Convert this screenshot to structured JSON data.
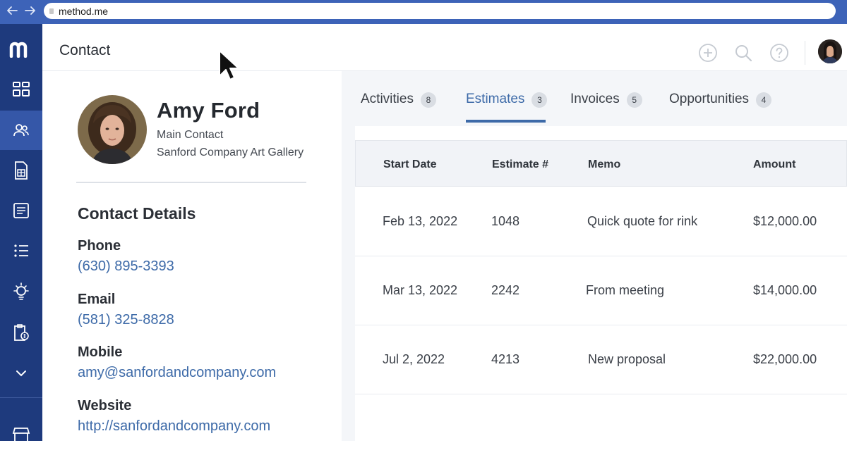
{
  "browser": {
    "url": "method.me"
  },
  "app": {
    "page_title": "Contact",
    "rail_items": [
      "dashboard-icon",
      "contacts-icon",
      "estimates-icon",
      "invoices-icon",
      "tasks-list-icon",
      "opportunities-icon",
      "payments-icon",
      "chevron-down-icon",
      "store-icon"
    ]
  },
  "contact": {
    "name": "Amy Ford",
    "role": "Main Contact",
    "company": "Sanford Company Art Gallery",
    "details_title": "Contact Details",
    "fields": [
      {
        "label": "Phone",
        "value": "(630) 895-3393"
      },
      {
        "label": "Email",
        "value": "(581) 325-8828"
      },
      {
        "label": "Mobile",
        "value": "amy@sanfordandcompany.com"
      },
      {
        "label": "Website",
        "value": "http://sanfordandcompany.com"
      }
    ]
  },
  "tabs": [
    {
      "label": "Activities",
      "count": "8"
    },
    {
      "label": "Estimates",
      "count": "3"
    },
    {
      "label": "Invoices",
      "count": "5"
    },
    {
      "label": "Opportunities",
      "count": "4"
    }
  ],
  "active_tab": "Estimates",
  "table": {
    "headers": [
      "Start Date",
      "Estimate #",
      "Memo",
      "Amount"
    ],
    "rows": [
      [
        "Feb 13, 2022",
        "1048",
        "Quick quote for rink",
        "$12,000.00"
      ],
      [
        "Mar 13, 2022",
        "2242",
        "From meeting",
        "$14,000.00"
      ],
      [
        "Jul 2, 2022",
        "4213",
        "New proposal",
        "$22,000.00"
      ]
    ]
  },
  "colors": {
    "rail": "#1e3a7d",
    "rail_active": "#3557a8",
    "accent": "#3d6aa8",
    "browser_bar": "#3d63b8"
  }
}
